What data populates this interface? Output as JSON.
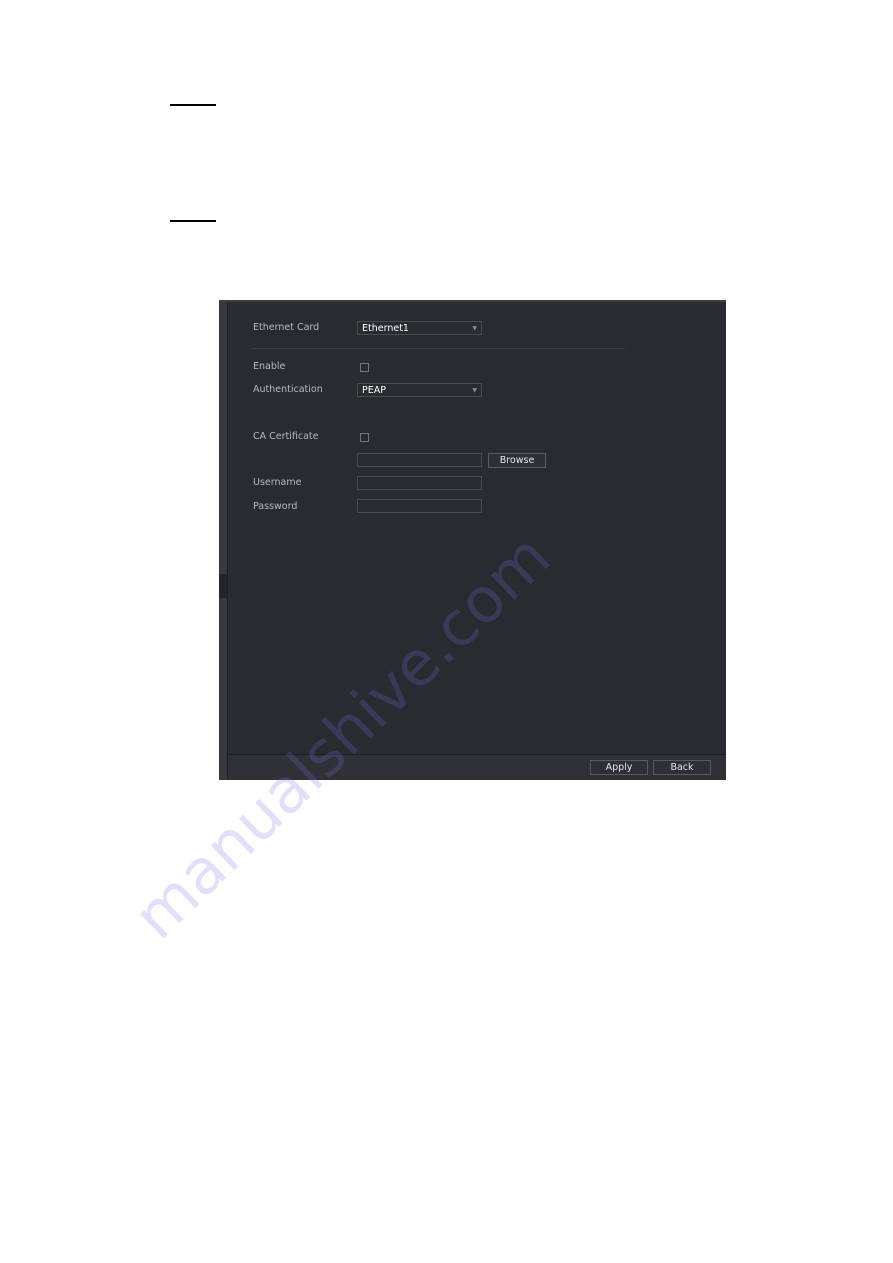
{
  "dialog": {
    "ethernet_card_label": "Ethernet Card",
    "ethernet_card_value": "Ethernet1",
    "enable_label": "Enable",
    "enable_checked": false,
    "authentication_label": "Authentication",
    "authentication_value": "PEAP",
    "ca_certificate_label": "CA Certificate",
    "ca_certificate_checked": false,
    "certificate_path_value": "",
    "browse_label": "Browse",
    "username_label": "Username",
    "username_value": "",
    "password_label": "Password",
    "password_value": "",
    "apply_label": "Apply",
    "back_label": "Back"
  },
  "icons": {
    "dropdown_arrow": "▼"
  },
  "watermark": "manualshive.com"
}
